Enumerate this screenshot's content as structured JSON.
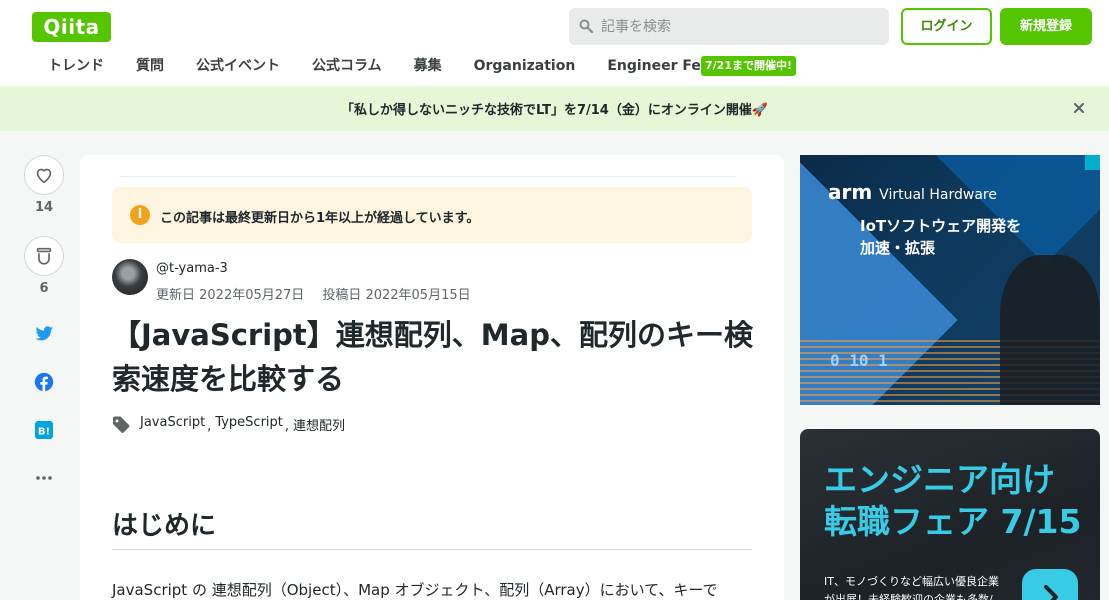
{
  "header": {
    "logo": "Qiita",
    "search_placeholder": "記事を検索",
    "login": "ログイン",
    "signup": "新規登録",
    "nav": [
      "トレンド",
      "質問",
      "公式イベント",
      "公式コラム",
      "募集",
      "Organization",
      "Engineer Festa"
    ],
    "nav_badge": "7/21まで開催中!"
  },
  "banner": {
    "text": "「私しか得しないニッチな技術でLT」を7/14（金）にオンライン開催🚀"
  },
  "sidebar": {
    "like_count": "14",
    "stock_count": "6"
  },
  "article": {
    "notice": "この記事は最終更新日から1年以上が経過しています。",
    "author": "@t-yama-3",
    "updated": "更新日 2022年05月27日",
    "posted": "投稿日 2022年05月15日",
    "title": "【JavaScript】連想配列、Map、配列のキー検索速度を比較する",
    "tags": [
      "JavaScript",
      "TypeScript",
      "連想配列"
    ],
    "heading": "はじめに",
    "body_first_line": "JavaScript の 連想配列（Object）、Map オブジェクト、配列（Array）において、キーで"
  },
  "ads": {
    "arm_brand": "arm",
    "arm_product": "Virtual Hardware",
    "arm_copy_1": "IoTソフトウェア開発を",
    "arm_copy_2": "加速・拡張",
    "arm_digits": "0  10  1",
    "fair_title_1": "エンジニア向け",
    "fair_title_2": "転職フェア 7/15",
    "fair_sub_1": "IT、モノづくりなど幅広い優良企業",
    "fair_sub_2": "が出展！未経験歓迎の企業も多数/"
  },
  "colors": {
    "brand_green": "#55c500",
    "banner_bg": "#e5f7d6",
    "notice_bg": "#fdf5e0",
    "twitter": "#1d9bf0",
    "facebook": "#1877f2",
    "hatena": "#00a4de",
    "fair_accent": "#38cbe6"
  }
}
